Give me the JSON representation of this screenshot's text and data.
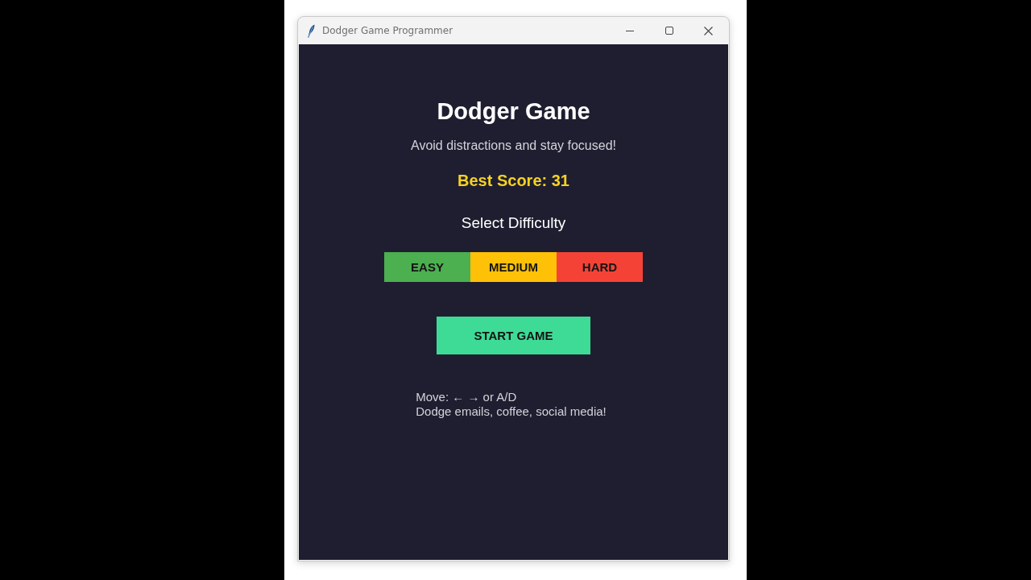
{
  "window": {
    "title": "Dodger Game Programmer"
  },
  "header": {
    "title": "Dodger Game",
    "subtitle": "Avoid distractions and stay focused!",
    "best_score": "Best Score: 31"
  },
  "difficulty": {
    "label": "Select Difficulty",
    "options": [
      {
        "label": "EASY",
        "color": "#4caf50"
      },
      {
        "label": "MEDIUM",
        "color": "#ffc107"
      },
      {
        "label": "HARD",
        "color": "#f44336"
      }
    ]
  },
  "start_button": "START GAME",
  "instructions": [
    "Move: ← → or A/D",
    "Dodge emails, coffee, social media!"
  ]
}
